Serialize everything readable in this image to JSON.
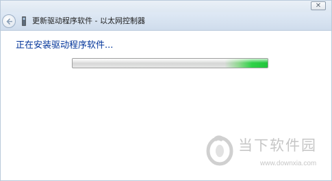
{
  "window": {
    "title": "更新驱动程序软件 - 以太网控制器",
    "close_label": "✕"
  },
  "icons": {
    "back": "back-arrow-icon",
    "device": "network-adapter-icon",
    "close": "close-icon"
  },
  "main": {
    "status_text": "正在安装驱动程序软件...",
    "progress": {
      "style": "marquee",
      "accent_color": "#2fd148"
    }
  },
  "watermark": {
    "name": "当下软件园",
    "url": "www.downxia.com"
  }
}
